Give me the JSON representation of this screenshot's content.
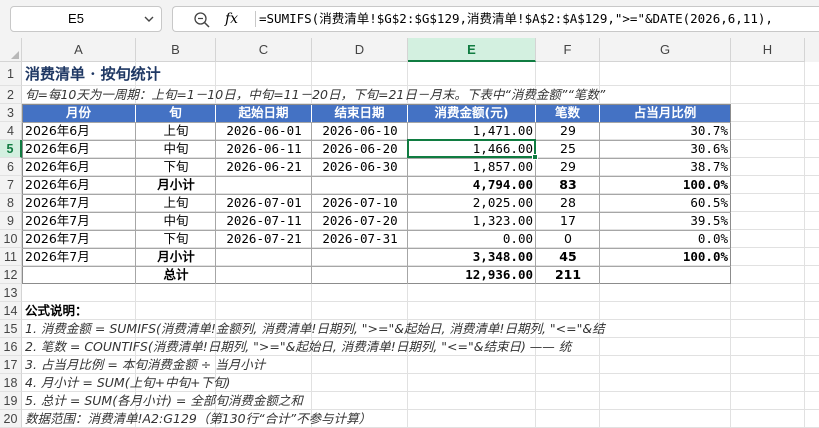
{
  "formula_bar": {
    "name_box": "E5",
    "fx_label": "fx",
    "formula": "=SUMIFS(消费清单!$G$2:$G$129,消费清单!$A$2:$A$129,\">=\"&DATE(2026,6,11),"
  },
  "columns": [
    "A",
    "B",
    "C",
    "D",
    "E",
    "F",
    "G",
    "H"
  ],
  "rows": [
    "1",
    "2",
    "3",
    "4",
    "5",
    "6",
    "7",
    "8",
    "9",
    "10",
    "11",
    "12",
    "13",
    "14",
    "15",
    "16",
    "17",
    "18",
    "19",
    "20"
  ],
  "sheet": {
    "title": "消费清单 · 按旬统计",
    "subtitle": "旬=每10天为一周期：上旬=1－10日，中旬=11－20日，下旬=21日－月末。下表中“消费金额”“笔数”",
    "headers": [
      "月份",
      "旬",
      "起始日期",
      "结束日期",
      "消费金额(元)",
      "笔数",
      "占当月比例"
    ],
    "data_rows": [
      {
        "month": "2026年6月",
        "xun": "上旬",
        "start": "2026-06-01",
        "end": "2026-06-10",
        "amount": "1,471.00",
        "count": "29",
        "pct": "30.7%"
      },
      {
        "month": "2026年6月",
        "xun": "中旬",
        "start": "2026-06-11",
        "end": "2026-06-20",
        "amount": "1,466.00",
        "count": "25",
        "pct": "30.6%"
      },
      {
        "month": "2026年6月",
        "xun": "下旬",
        "start": "2026-06-21",
        "end": "2026-06-30",
        "amount": "1,857.00",
        "count": "29",
        "pct": "38.7%"
      },
      {
        "month": "2026年6月",
        "xun": "月小计",
        "start": "",
        "end": "",
        "amount": "4,794.00",
        "count": "83",
        "pct": "100.0%"
      },
      {
        "month": "2026年7月",
        "xun": "上旬",
        "start": "2026-07-01",
        "end": "2026-07-10",
        "amount": "2,025.00",
        "count": "28",
        "pct": "60.5%"
      },
      {
        "month": "2026年7月",
        "xun": "中旬",
        "start": "2026-07-11",
        "end": "2026-07-20",
        "amount": "1,323.00",
        "count": "17",
        "pct": "39.5%"
      },
      {
        "month": "2026年7月",
        "xun": "下旬",
        "start": "2026-07-21",
        "end": "2026-07-31",
        "amount": "0.00",
        "count": "0",
        "pct": "0.0%"
      },
      {
        "month": "2026年7月",
        "xun": "月小计",
        "start": "",
        "end": "",
        "amount": "3,348.00",
        "count": "45",
        "pct": "100.0%"
      },
      {
        "month": "",
        "xun": "总计",
        "start": "",
        "end": "",
        "amount": "12,936.00",
        "count": "211",
        "pct": ""
      }
    ],
    "notes_title": "公式说明：",
    "notes": [
      "1. 消费金额 = SUMIFS(消费清单!金额列, 消费清单!日期列, \">=\"&起始日, 消费清单!日期列, \"<=\"&结",
      "2. 笔数     = COUNTIFS(消费清单!日期列, \">=\"&起始日, 消费清单!日期列, \"<=\"&结束日)  —— 统",
      "3. 占当月比例 = 本旬消费金额 ÷ 当月小计",
      "4. 月小计   = SUM(上旬+中旬+下旬)",
      "5. 总计     = SUM(各月小计) = 全部旬消费金额之和",
      "数据范围：消费清单!A2:G129（第130行“合计”不参与计算）"
    ]
  }
}
